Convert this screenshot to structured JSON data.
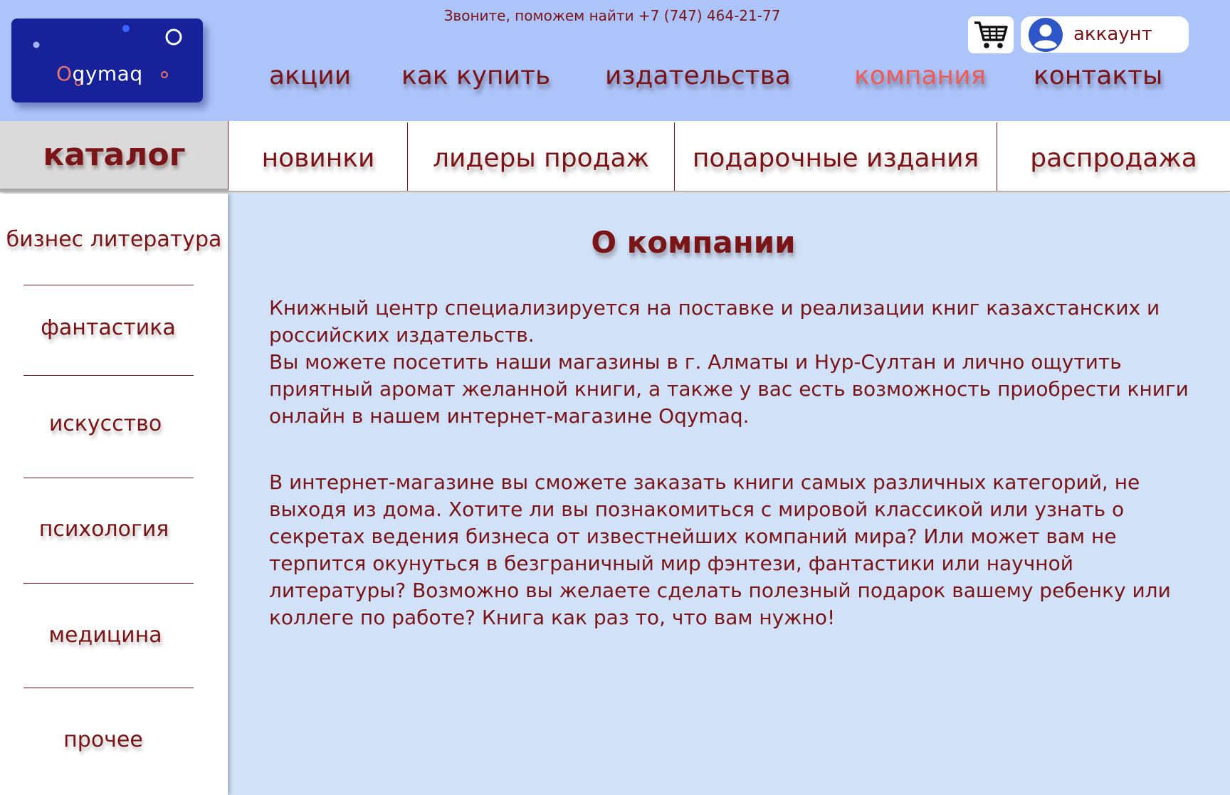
{
  "header": {
    "logo_text_first": "O",
    "logo_text_rest": "qymaq",
    "phone_text": "Звоните, поможем найти +7 (747) 464-21-77",
    "account_label": "аккаунт",
    "nav": [
      {
        "label": "акции"
      },
      {
        "label": "как купить"
      },
      {
        "label": "издательства"
      },
      {
        "label": "компания"
      },
      {
        "label": "контакты"
      }
    ]
  },
  "catalog_bar": {
    "catalog_label": "каталог",
    "tabs": [
      {
        "label": "новинки"
      },
      {
        "label": "лидеры продаж"
      },
      {
        "label": "подарочные издания"
      },
      {
        "label": "распродажа"
      }
    ]
  },
  "sidebar": {
    "items": [
      {
        "label": "бизнес литература"
      },
      {
        "label": "фантастика"
      },
      {
        "label": "искусство"
      },
      {
        "label": "психология"
      },
      {
        "label": "медицина"
      },
      {
        "label": "прочее"
      }
    ]
  },
  "main": {
    "title": "О компании",
    "paragraph_1a": "Книжный центр специализируется на поставке и реализации книг казахстанских и российских издательств.",
    "paragraph_1b": "Вы можете посетить наши магазины в г. Алматы и Нур-Султан и лично ощутить приятный аромат желанной книги, а также у вас есть возможность приобрести книги онлайн в нашем интернет-магазине Oqymaq.",
    "paragraph_2": "В интернет-магазине вы сможете заказать книги самых различных категорий, не выходя из дома. Хотите ли вы познакомиться с мировой классикой или узнать о секретах ведения бизнеса от известнейших компаний мира? Или может вам не терпится окунуться в безграничный мир фэнтези, фантастики или научной литературы? Возможно вы желаете сделать полезный подарок вашему ребенку или коллеге по работе? Книга как раз то, что вам нужно!"
  },
  "colors": {
    "header_bg": "#adc4fb",
    "main_bg": "#d1e2f8",
    "text": "#7a1416",
    "active_nav": "#ef5b58",
    "logo_bg": "#17229a"
  },
  "icons": {
    "cart": "shopping-cart-icon",
    "account": "user-avatar-icon"
  }
}
